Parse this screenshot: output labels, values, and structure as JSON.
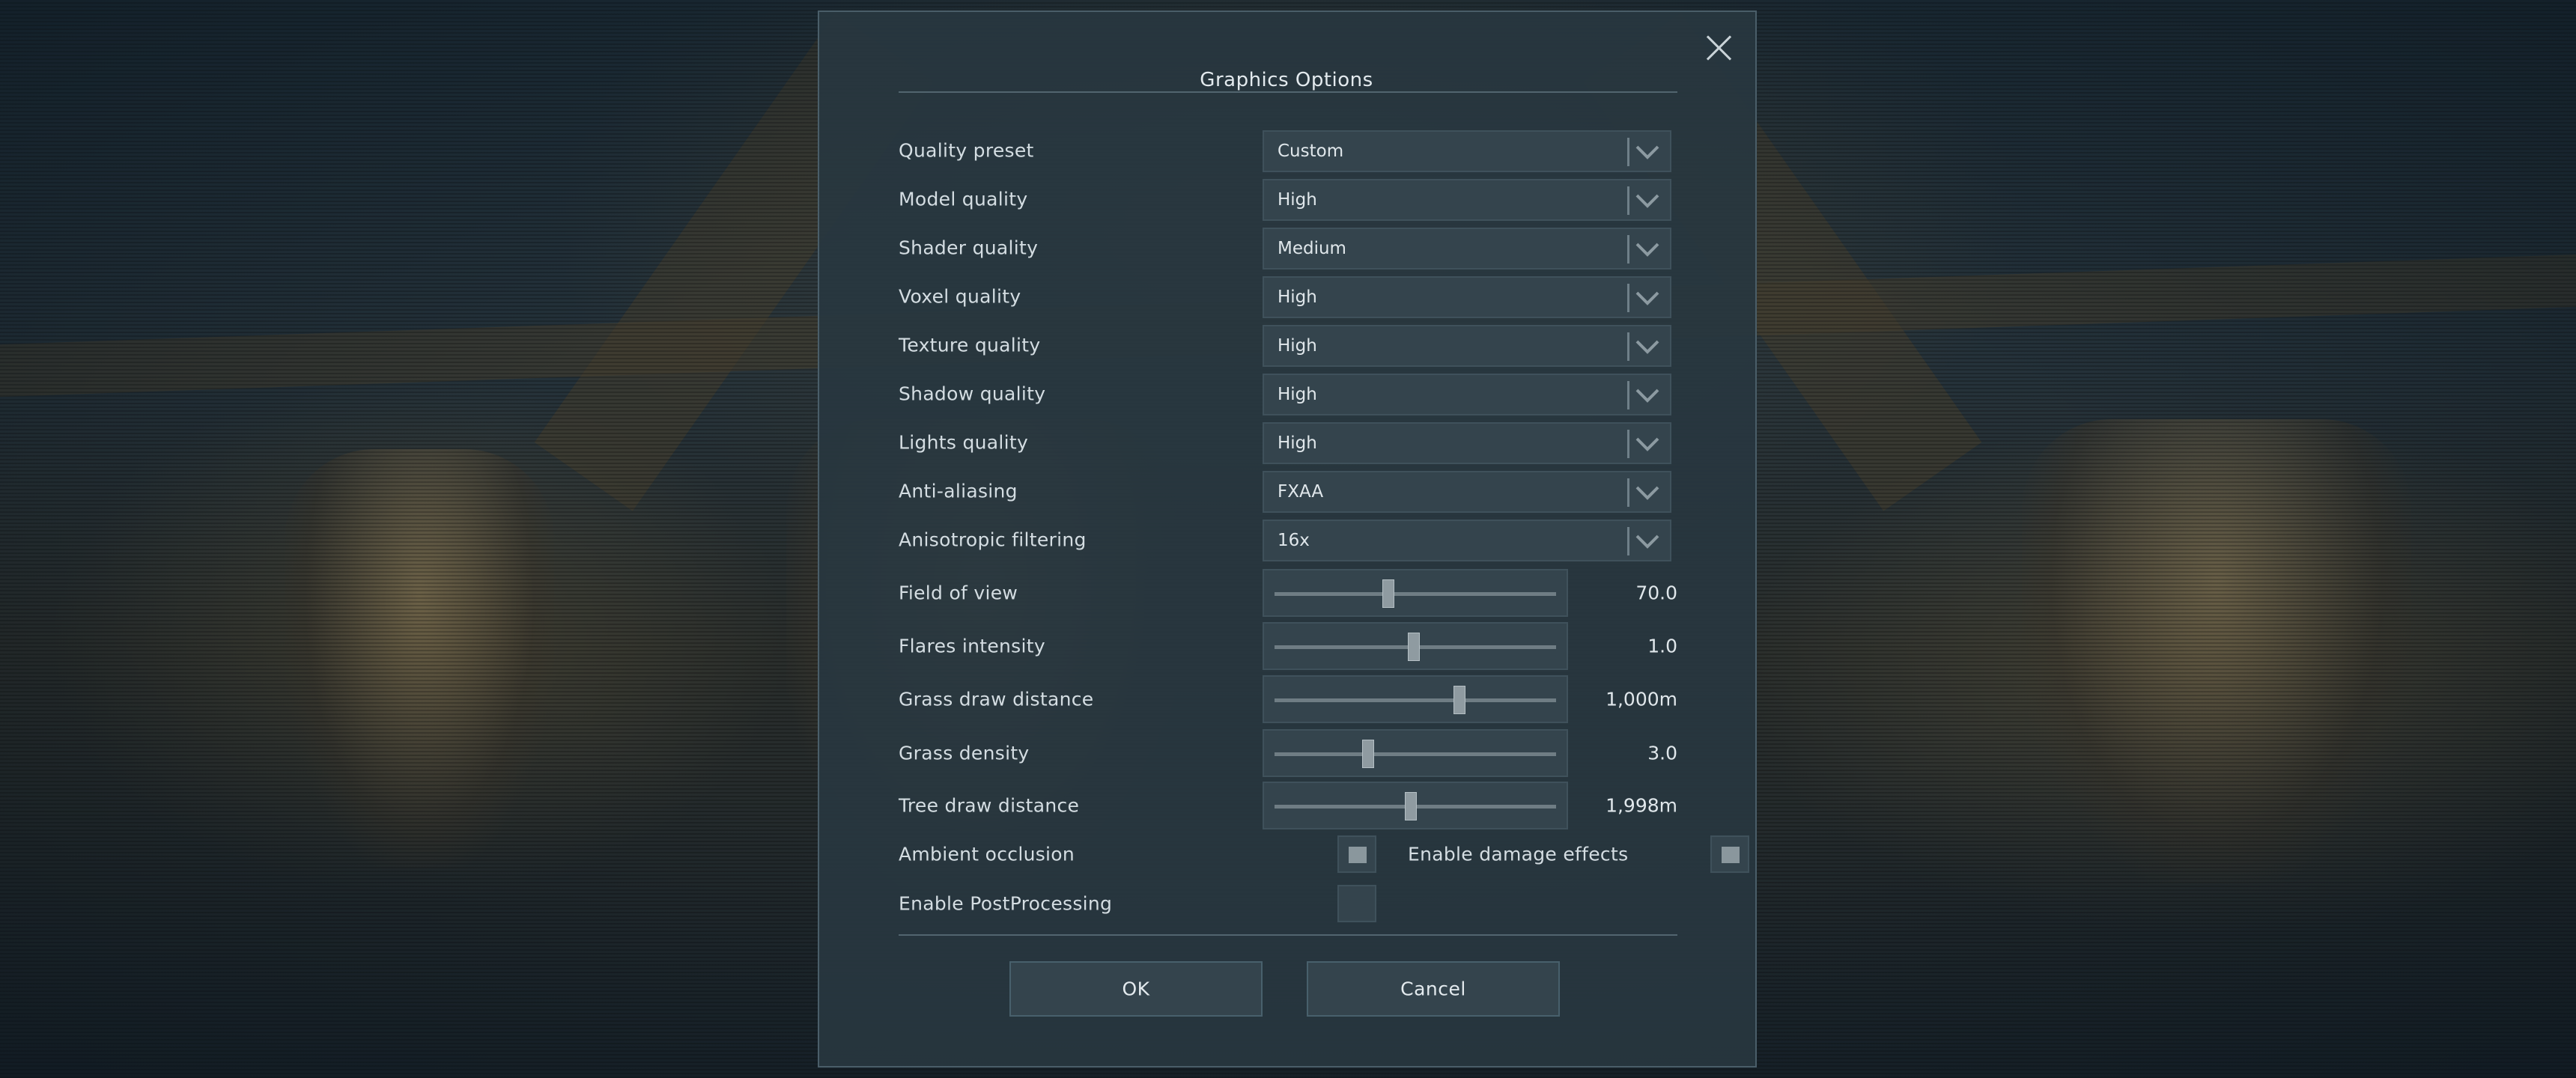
{
  "dialog": {
    "title": "Graphics Options"
  },
  "dropdowns": [
    {
      "label": "Quality preset",
      "value": "Custom"
    },
    {
      "label": "Model quality",
      "value": "High"
    },
    {
      "label": "Shader quality",
      "value": "Medium"
    },
    {
      "label": "Voxel quality",
      "value": "High"
    },
    {
      "label": "Texture quality",
      "value": "High"
    },
    {
      "label": "Shadow quality",
      "value": "High"
    },
    {
      "label": "Lights quality",
      "value": "High"
    },
    {
      "label": "Anti-aliasing",
      "value": "FXAA"
    },
    {
      "label": "Anisotropic filtering",
      "value": "16x"
    }
  ],
  "sliders": [
    {
      "label": "Field of view",
      "value": "70.0",
      "level": 0.4
    },
    {
      "label": "Flares intensity",
      "value": "1.0",
      "level": 0.49
    },
    {
      "label": "Grass draw distance",
      "value": "1,000m",
      "level": 0.65
    },
    {
      "label": "Grass density",
      "value": "3.0",
      "level": 0.33
    },
    {
      "label": "Tree draw distance",
      "value": "1,998m",
      "level": 0.48
    }
  ],
  "checkboxes": {
    "ambient_occlusion": {
      "label": "Ambient occlusion",
      "checked": true
    },
    "damage_effects": {
      "label": "Enable damage effects",
      "checked": true
    },
    "post_processing": {
      "label": "Enable PostProcessing",
      "checked": false
    }
  },
  "buttons": {
    "ok": "OK",
    "cancel": "Cancel"
  },
  "icons": {
    "close": "close-icon",
    "dropdown": "chevron-down-icon"
  }
}
